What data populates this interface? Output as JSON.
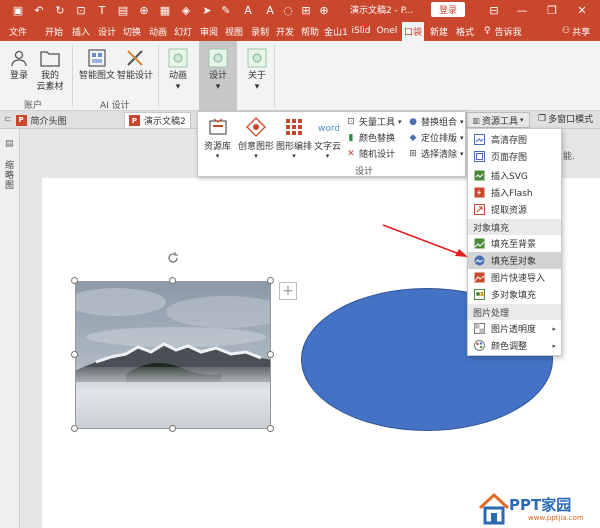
{
  "title_bar": {
    "doc_title": "演示文稿2 - P...",
    "login_label": "登录",
    "accent": "#c9472d"
  },
  "tabs": [
    "文件",
    "开始",
    "插入",
    "设计",
    "切换",
    "动画",
    "幻灯",
    "审阅",
    "视图",
    "录制",
    "开发",
    "帮助",
    "金山1",
    "iSlid",
    "Onel",
    "口袋",
    "新建",
    "格式"
  ],
  "active_tab": "口袋",
  "tell_me": "告诉我",
  "share": "共享",
  "ribbon": {
    "login": "登录",
    "my_cloud_line1": "我的",
    "my_cloud_line2": "云素材",
    "account_group": "账户",
    "smart_graphic_text": "智能图文",
    "smart_design": "智能设计",
    "ai_group": "AI 设计",
    "animation": "动画",
    "design": "设计",
    "about": "关于"
  },
  "doc_tabs": {
    "tab1": "简介头图",
    "tab2": "演示文稿2",
    "multi_window": "多窗口模式",
    "side_note": "能."
  },
  "left_panel": {
    "label": "缩略图"
  },
  "design_panel": {
    "resource_lib": "资源库",
    "creative_shape": "创意图形",
    "shape_layout": "图形编排",
    "word_cloud": "文字云",
    "vector_tool": "矢量工具",
    "color_replace": "颜色替换",
    "random_design": "随机设计",
    "replace_combo": "替换组合",
    "locate_arrange": "定位排版",
    "select_clear": "选择清除",
    "group_label": "设计"
  },
  "resource_menu": {
    "tab_label": "资源工具",
    "items_top": [
      "高清存图",
      "页面存图",
      "插入SVG",
      "插入Flash",
      "提取资源"
    ],
    "header_fill": "对象填充",
    "items_fill": [
      "填充至背景",
      "填充至对象",
      "图片快速导入",
      "多对象填充"
    ],
    "highlighted": "填充至对象",
    "header_image": "图片处理",
    "items_image": [
      "图片透明度",
      "颜色调整"
    ]
  },
  "shape_color": "#4472c4",
  "watermark": {
    "title": "PPT家园",
    "url": "www.pptjia.com"
  }
}
